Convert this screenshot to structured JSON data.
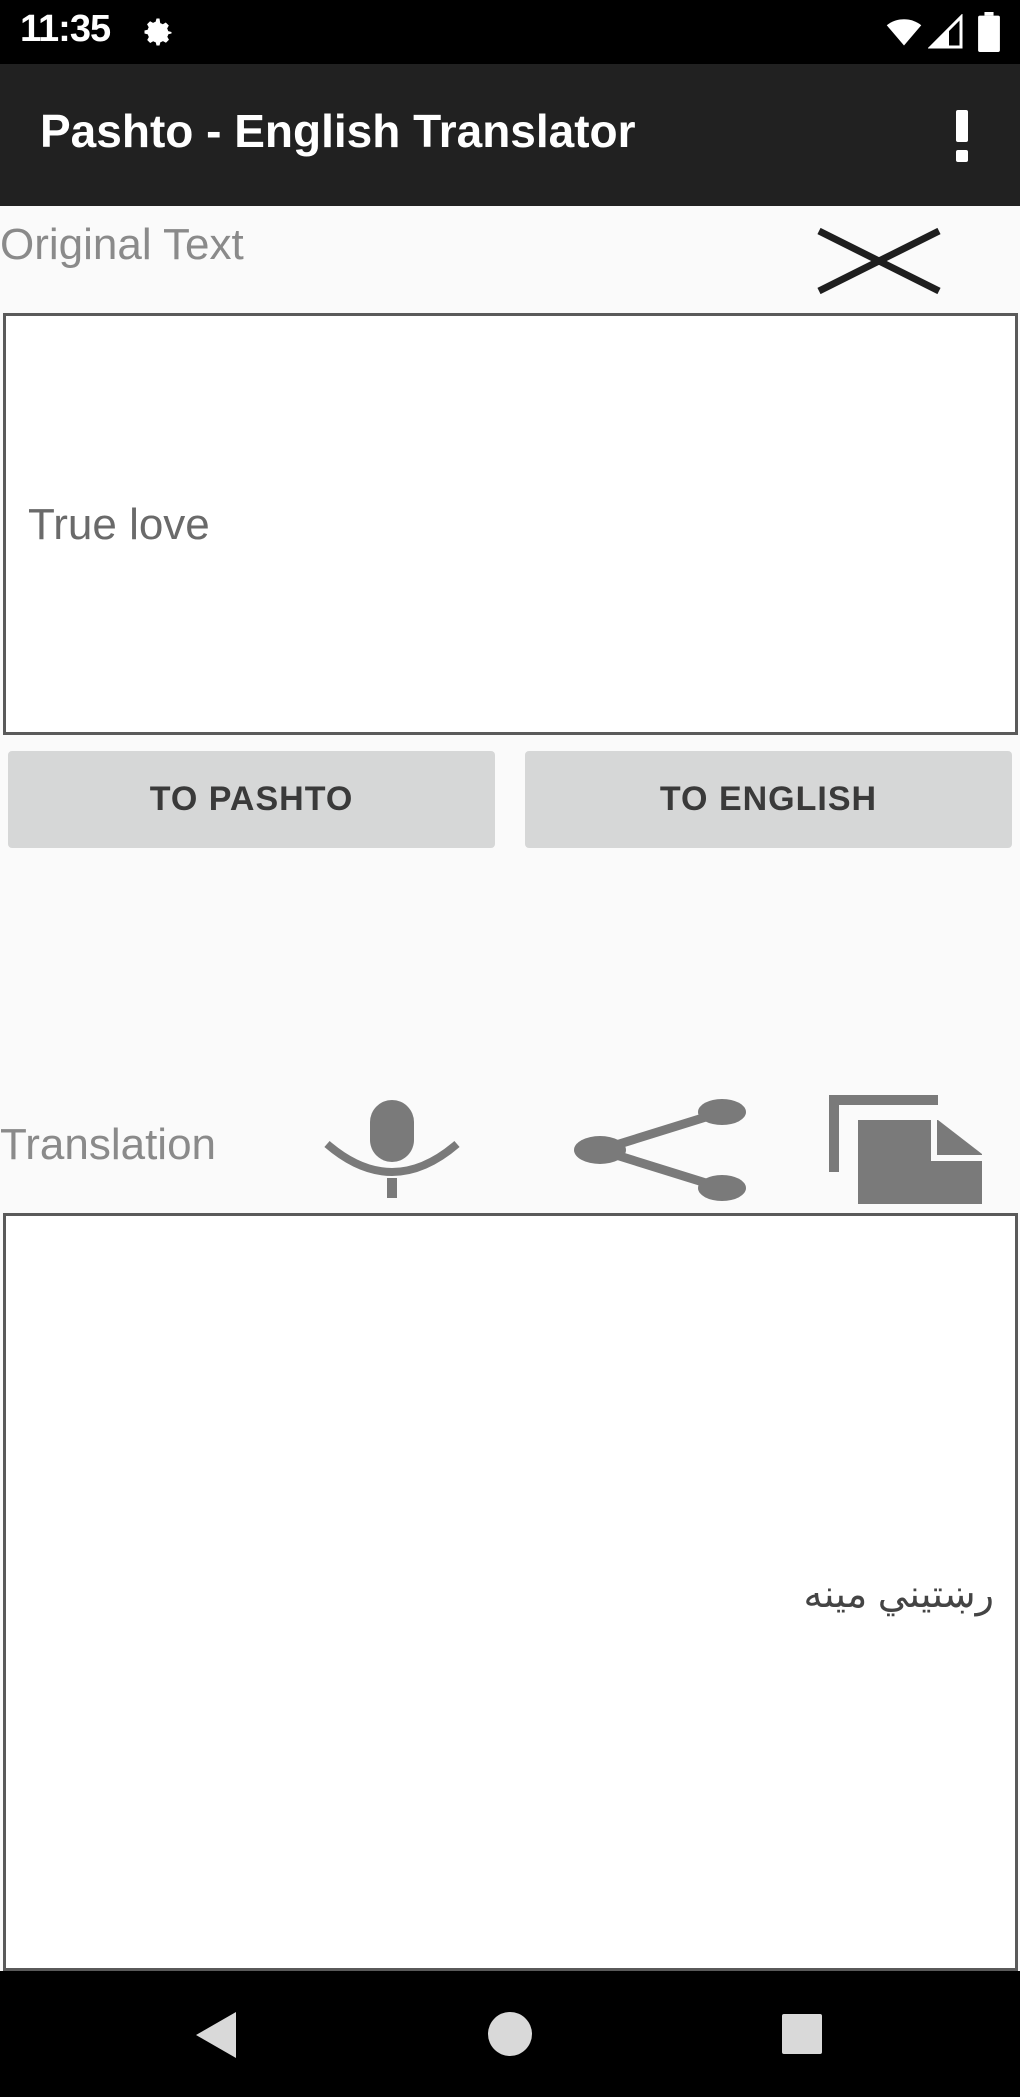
{
  "status_bar": {
    "time": "11:35",
    "icons": [
      "settings-icon",
      "wifi-icon",
      "signal-icon",
      "battery-icon"
    ]
  },
  "app_bar": {
    "title": "Pashto - English Translator",
    "menu_icon": "overflow-menu-icon"
  },
  "original": {
    "label": "Original Text",
    "text": "True love",
    "clear_icon": "close-icon"
  },
  "buttons": {
    "to_pashto": "TO PASHTO",
    "to_english": "TO ENGLISH"
  },
  "translation": {
    "label": "Translation",
    "text": "رښتيني مينه",
    "icons": [
      "microphone-icon",
      "share-icon",
      "copy-icon"
    ]
  },
  "nav_bar": {
    "icons": [
      "back-icon",
      "home-icon",
      "recents-icon"
    ]
  },
  "colors": {
    "status_bar": "#000000",
    "app_bar": "#212121",
    "background": "#fafafa",
    "button_bg": "#d6d7d7",
    "icon_gray": "#7a7a7a"
  }
}
